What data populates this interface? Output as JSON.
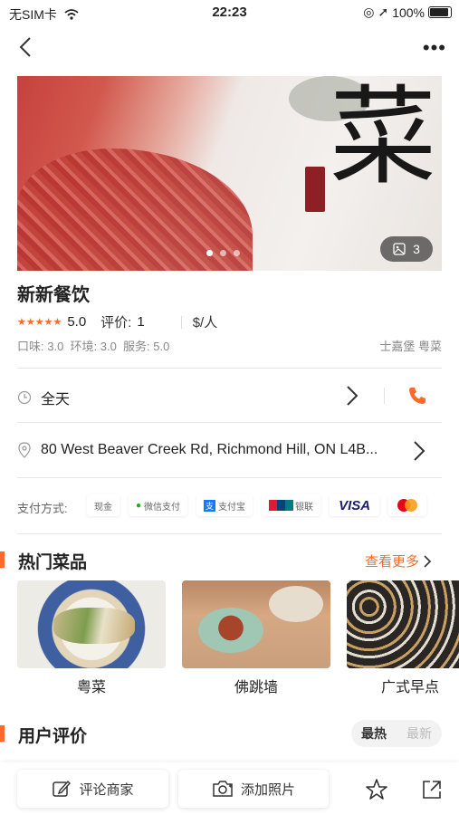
{
  "status": {
    "carrier": "无SIM卡",
    "time": "22:23",
    "battery": "100%"
  },
  "hero": {
    "char": "菜",
    "photo_count": "3"
  },
  "restaurant": {
    "name": "新新餐饮",
    "score": "5.0",
    "reviews_label": "评价:",
    "reviews_count": "1",
    "price": "$/人",
    "sub_scores": "口味: 3.0  环境: 3.0  服务: 5.0",
    "cuisine": "士嘉堡 粤菜"
  },
  "hours": "全天",
  "address": "80 West Beaver Creek Rd, Richmond Hill, ON L4B...",
  "payment": {
    "label": "支付方式:",
    "methods": [
      "现金",
      "微信支付",
      "支付宝",
      "银联",
      "VISA",
      "Mastercard"
    ]
  },
  "popular": {
    "title": "热门菜品",
    "see_more": "查看更多",
    "dishes": [
      "粤菜",
      "佛跳墙",
      "广式早点"
    ]
  },
  "reviews": {
    "title": "用户评价",
    "tab_hot": "最热",
    "tab_new": "最新"
  },
  "bottom": {
    "comment": "评论商家",
    "add_photo": "添加照片"
  },
  "colors": {
    "accent": "#ff6a2a"
  }
}
